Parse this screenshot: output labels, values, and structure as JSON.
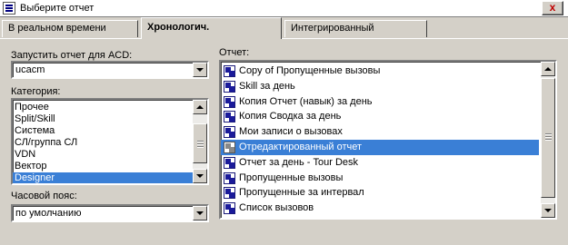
{
  "window": {
    "title": "Выберите отчет",
    "close_label": "x"
  },
  "tabs": [
    {
      "label": "В реальном времени"
    },
    {
      "label": "Хронологич."
    },
    {
      "label": "Интегрированный"
    }
  ],
  "acd": {
    "label": "Запустить отчет для ACD:",
    "value": "ucacm"
  },
  "category": {
    "label": "Категория:",
    "items": [
      "Прочее",
      "Split/Skill",
      "Система",
      "СЛ/группа СЛ",
      "VDN",
      "Вектор",
      "Designer"
    ],
    "selected": "Designer"
  },
  "timezone": {
    "label": "Часовой пояс:",
    "value": "по умолчанию"
  },
  "report": {
    "label": "Отчет:",
    "items": [
      "Copy of Пропущенные вызовы",
      "Skill за день",
      "Копия Отчет (навык) за день",
      "Копия Сводка за день",
      "Мои записи о вызовах",
      "Отредактированный отчет",
      "Отчет за день - Tour Desk",
      "Пропущенные вызовы",
      "Пропущенные за интервал",
      "Список вызовов"
    ],
    "selected": "Отредактированный отчет",
    "icon": "report-icon"
  },
  "colors": {
    "selection": "#3a7fd6",
    "dialog_bg": "#d4d0c8"
  }
}
